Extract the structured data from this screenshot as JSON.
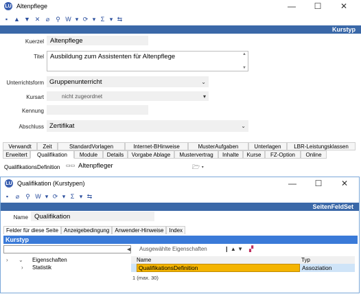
{
  "main_window": {
    "title": "Altenpflege",
    "icon_text": "LU",
    "controls": {
      "minimize": "—",
      "maximize": "☐",
      "close": "✕"
    },
    "bluebar": "Kurstyp"
  },
  "form": {
    "kuerzel_label": "Kuerzel",
    "kuerzel_value": "Altenpflege",
    "titel_label": "Titel",
    "titel_value": "Ausbildung zum Assistenten für Altenpflege",
    "unterrichtsform_label": "Unterrichtsform",
    "unterrichtsform_value": "Gruppenunterricht",
    "kursart_label": "Kursart",
    "kursart_value": "nicht zugeordnet",
    "kennung_label": "Kennung",
    "kennung_value": "",
    "abschluss_label": "Abschluss",
    "abschluss_value": "Zertifikat"
  },
  "tabs_row1": [
    "Verwandt",
    "Zeit",
    "StandardVorlagen",
    "Internet-BHinweise",
    "MusterAufgaben",
    "Unterlagen",
    "LBR-Leistungsklassen"
  ],
  "tabs_row2": [
    "Erweitert",
    "Qualifikation",
    "Module",
    "Details",
    "Vorgabe Ablage",
    "Mustervertrag",
    "Inhalte",
    "Kurse",
    "FZ-Option",
    "Online"
  ],
  "qualifikation": {
    "label": "QualifikationsDefinition",
    "value": "Altenpfleger"
  },
  "child_window": {
    "title": "Qualifikation (Kurstypen)",
    "icon_text": "LU",
    "controls": {
      "minimize": "—",
      "maximize": "☐",
      "close": "✕"
    },
    "bluebar": "SeitenFeldSet",
    "name_label": "Name",
    "name_value": "Qualifikation",
    "subtabs": [
      "Felder für diese Seite",
      "Anzeigebedingung",
      "Anwender-Hinweise",
      "Index"
    ],
    "section_header": "Kurstyp",
    "selected_props_label": "Ausgewählte Eigenschaften",
    "tree": [
      {
        "label": "Eigenschaften"
      },
      {
        "label": "Statistik"
      }
    ],
    "columns": [
      "Name",
      "Typ"
    ],
    "rows": [
      {
        "name": "QualifikationsDefinition",
        "typ": "Assoziation"
      }
    ],
    "count_text": "1 (max. 30)"
  }
}
